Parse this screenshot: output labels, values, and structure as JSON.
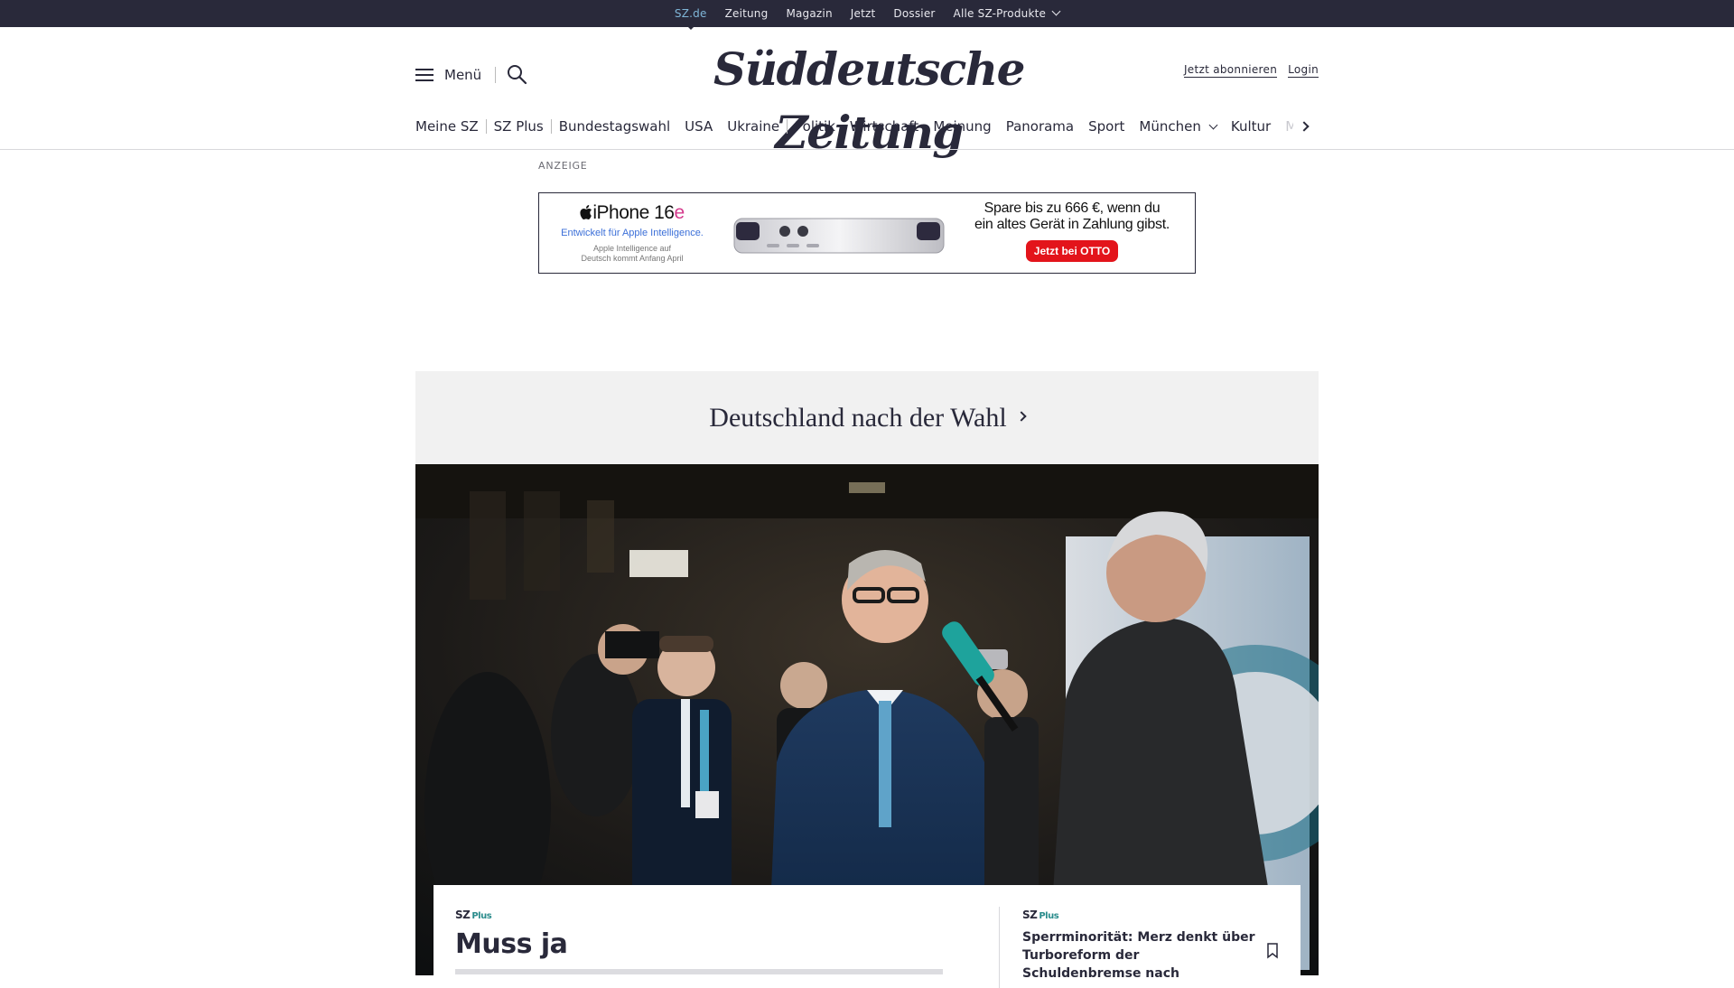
{
  "topbar": {
    "links": [
      "SZ.de",
      "Zeitung",
      "Magazin",
      "Jetzt",
      "Dossier"
    ],
    "products_label": "Alle SZ-Produkte"
  },
  "header": {
    "menu_label": "Menü",
    "logo": "Süddeutsche Zeitung",
    "subscribe_label": "Jetzt abonnieren",
    "login_label": "Login"
  },
  "nav": {
    "group1": [
      "Meine SZ"
    ],
    "group2": [
      "SZ Plus"
    ],
    "group3": [
      "Bundestagswahl",
      "USA",
      "Ukraine"
    ],
    "group4": [
      "Politik",
      "Wirtschaft",
      "Meinung",
      "Panorama",
      "Sport"
    ],
    "muenchen": "München",
    "kultur": "Kultur",
    "faded": "M"
  },
  "ad": {
    "label": "ANZEIGE",
    "product": "iPhone 16",
    "product_suffix": "e",
    "tagline": "Entwickelt für Apple Intelligence.",
    "note_line1": "Apple Intelligence auf",
    "note_line2": "Deutsch kommt Anfang April",
    "headline_line1": "Spare bis zu 666 €, wenn du",
    "headline_line2": "ein altes Gerät in Zahlung gibst.",
    "cta": "Jetzt bei OTTO"
  },
  "section": {
    "title": "Deutschland nach der Wahl"
  },
  "teaser": {
    "badge": "SZ",
    "badge_plus": "Plus",
    "title": "Muss ja"
  },
  "side_teaser": {
    "badge": "SZ",
    "badge_plus": "Plus",
    "title": "Sperrminorität: Merz denkt über Turboreform der Schuldenbremse nach"
  },
  "colors": {
    "topbar": "#29293a",
    "active_link": "#7fb6d8",
    "banner_bg": "#f1f1f1",
    "plus_accent": "#2a8c8c",
    "ad_cta": "#e3141b"
  }
}
